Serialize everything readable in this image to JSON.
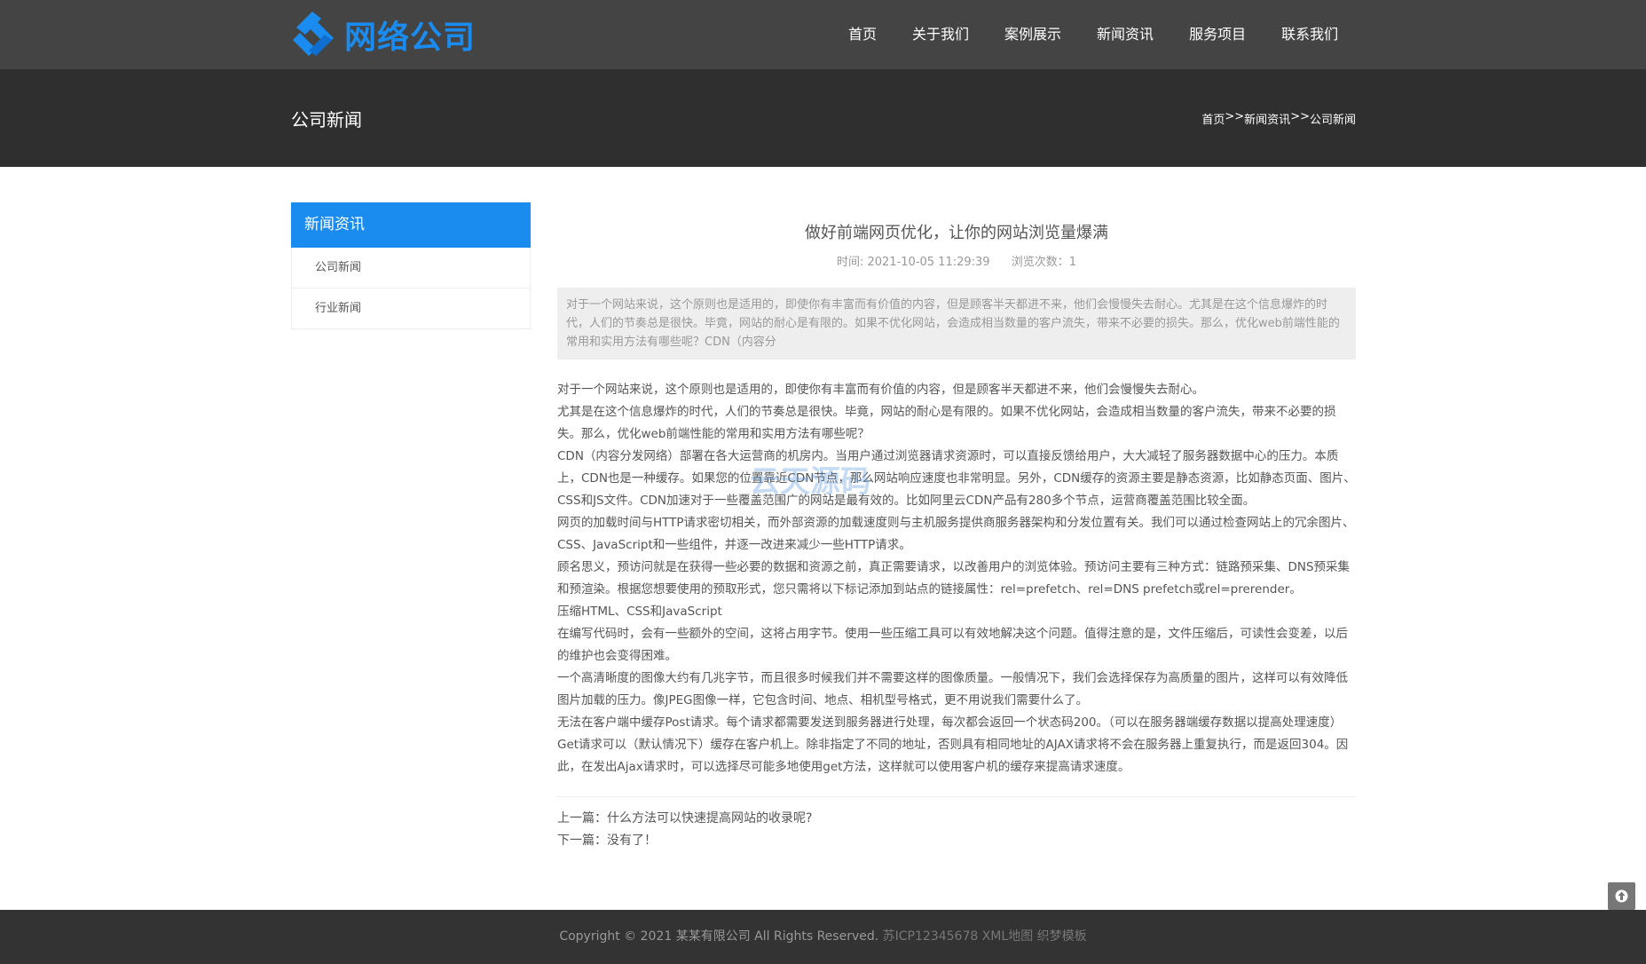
{
  "brand": {
    "name": "网络公司",
    "color": "#1a8cf0"
  },
  "nav": [
    {
      "label": "首页"
    },
    {
      "label": "关于我们"
    },
    {
      "label": "案例展示"
    },
    {
      "label": "新闻资讯"
    },
    {
      "label": "服务项目"
    },
    {
      "label": "联系我们"
    }
  ],
  "banner": {
    "title": "公司新闻",
    "breadcrumb": [
      "首页",
      "新闻资讯",
      "公司新闻"
    ],
    "separator": ">>"
  },
  "sidebar": {
    "heading": "新闻资讯",
    "items": [
      "公司新闻",
      "行业新闻"
    ]
  },
  "article": {
    "title": "做好前端网页优化，让你的网站浏览量爆满",
    "time": "时间: 2021-10-05 11:29:39",
    "views": "浏览次数：1",
    "summary": "对于一个网站来说，这个原则也是适用的，即使你有丰富而有价值的内容，但是顾客半天都进不来，他们会慢慢失去耐心。尤其是在这个信息爆炸的时代，人们的节奏总是很快。毕竟，网站的耐心是有限的。如果不优化网站，会造成相当数量的客户流失，带来不必要的损失。那么，优化web前端性能的常用和实用方法有哪些呢？CDN（内容分",
    "paragraphs": [
      "对于一个网站来说，这个原则也是适用的，即使你有丰富而有价值的内容，但是顾客半天都进不来，他们会慢慢失去耐心。",
      "尤其是在这个信息爆炸的时代，人们的节奏总是很快。毕竟，网站的耐心是有限的。如果不优化网站，会造成相当数量的客户流失，带来不必要的损失。那么，优化web前端性能的常用和实用方法有哪些呢？",
      "CDN（内容分发网络）部署在各大运营商的机房内。当用户通过浏览器请求资源时，可以直接反馈给用户，大大减轻了服务器数据中心的压力。本质上，CDN也是一种缓存。如果您的位置靠近CDN节点，那么网站响应速度也非常明显。另外，CDN缓存的资源主要是静态资源，比如静态页面、图片、CSS和JS文件。CDN加速对于一些覆盖范围广的网站是最有效的。比如阿里云CDN产品有280多个节点，运营商覆盖范围比较全面。",
      "网页的加载时间与HTTP请求密切相关，而外部资源的加载速度则与主机服务提供商服务器架构和分发位置有关。我们可以通过检查网站上的冗余图片、CSS、JavaScript和一些组件，并逐一改进来减少一些HTTP请求。",
      "顾名思义，预访问就是在获得一些必要的数据和资源之前，真正需要请求，以改善用户的浏览体验。预访问主要有三种方式：链路预采集、DNS预采集和预渲染。根据您想要使用的预取形式，您只需将以下标记添加到站点的链接属性：rel=prefetch、rel=DNS prefetch或rel=prerender。",
      "压缩HTML、CSS和JavaScript",
      "在编写代码时，会有一些额外的空间，这将占用字节。使用一些压缩工具可以有效地解决这个问题。值得注意的是，文件压缩后，可读性会变差，以后的维护也会变得困难。",
      "一个高清晰度的图像大约有几兆字节，而且很多时候我们并不需要这样的图像质量。一般情况下，我们会选择保存为高质量的图片，这样可以有效降低图片加载的压力。像JPEG图像一样，它包含时间、地点、相机型号格式，更不用说我们需要什么了。",
      "无法在客户端中缓存Post请求。每个请求都需要发送到服务器进行处理，每次都会返回一个状态码200。（可以在服务器端缓存数据以提高处理速度）",
      "Get请求可以（默认情况下）缓存在客户机上。除非指定了不同的地址，否则具有相同地址的AJAX请求将不会在服务器上重复执行，而是返回304。因此，在发出Ajax请求时，可以选择尽可能多地使用get方法，这样就可以使用客户机的缓存来提高请求速度。"
    ],
    "prev": "上一篇：什么方法可以快速提高网站的收录呢?",
    "next": "下一篇：没有了！"
  },
  "watermark": "云天源码",
  "footer": {
    "copyright": "Copyright © 2021 某某有限公司 All Rights Reserved.",
    "icp": "苏ICP12345678",
    "sitemap": "XML地图",
    "theme": "织梦模板"
  },
  "icons": {
    "back_to_top": "arrow-up-icon",
    "logo": "logo-mark-icon"
  }
}
